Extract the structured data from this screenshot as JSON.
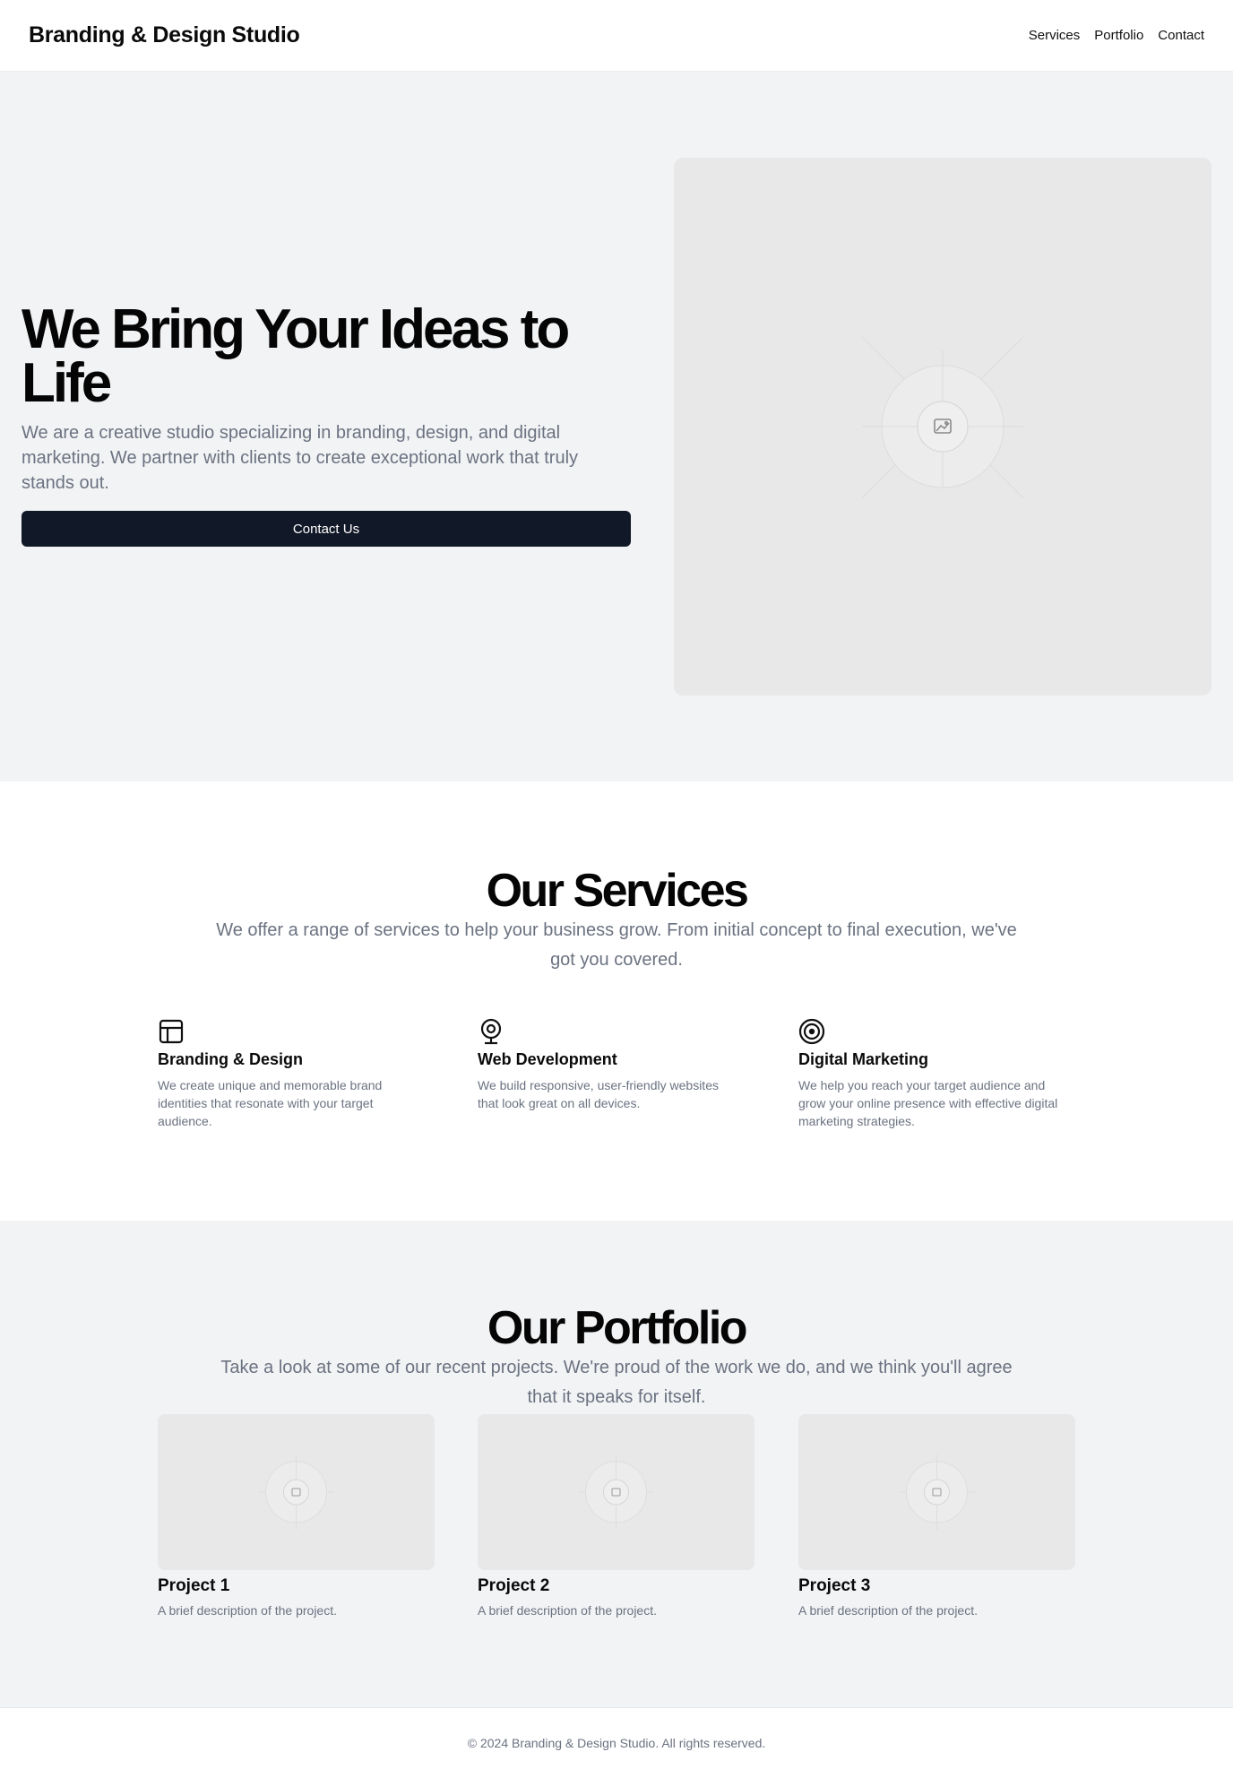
{
  "header": {
    "brand": "Branding & Design Studio",
    "nav": [
      "Services",
      "Portfolio",
      "Contact"
    ]
  },
  "hero": {
    "title": "We Bring Your Ideas to Life",
    "subtitle": "We are a creative studio specializing in branding, design, and digital marketing. We partner with clients to create exceptional work that truly stands out.",
    "button_label": "Contact Us",
    "image_icon": "image-placeholder-icon"
  },
  "services": {
    "title": "Our Services",
    "subtitle": "We offer a range of services to help your business grow. From initial concept to final execution, we've got you covered.",
    "items": [
      {
        "icon": "layout-icon",
        "title": "Branding & Design",
        "description": "We create unique and memorable brand identities that resonate with your target audience."
      },
      {
        "icon": "webcam-icon",
        "title": "Web Development",
        "description": "We build responsive, user-friendly websites that look great on all devices."
      },
      {
        "icon": "target-icon",
        "title": "Digital Marketing",
        "description": "We help you reach your target audience and grow your online presence with effective digital marketing strategies."
      }
    ]
  },
  "portfolio": {
    "title": "Our Portfolio",
    "subtitle": "Take a look at some of our recent projects. We're proud of the work we do, and we think you'll agree that it speaks for itself.",
    "projects": [
      {
        "title": "Project 1",
        "description": "A brief description of the project."
      },
      {
        "title": "Project 2",
        "description": "A brief description of the project."
      },
      {
        "title": "Project 3",
        "description": "A brief description of the project."
      }
    ]
  },
  "footer": {
    "copyright": "© 2024 Branding & Design Studio. All rights reserved."
  },
  "colors": {
    "primary_button": "#111827",
    "section_gray": "#f2f3f5",
    "placeholder": "#e8e8e8",
    "muted_text": "#6b7280"
  }
}
